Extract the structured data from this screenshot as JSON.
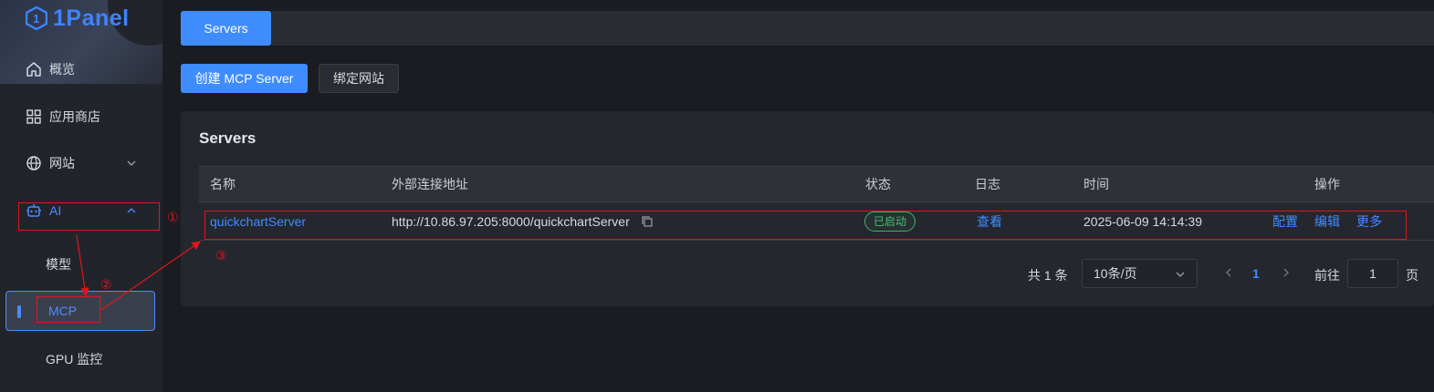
{
  "brand": {
    "name": "1Panel",
    "color": "#3f83ff"
  },
  "sidebar": {
    "items": [
      {
        "label": "概览",
        "icon": "home-icon"
      },
      {
        "label": "应用商店",
        "icon": "grid-icon"
      },
      {
        "label": "网站",
        "icon": "globe-icon"
      },
      {
        "label": "AI",
        "icon": "robot-icon"
      }
    ],
    "ai_children": [
      {
        "label": "模型"
      },
      {
        "label": "MCP",
        "active": true
      },
      {
        "label": "GPU 监控"
      }
    ]
  },
  "tabs": [
    {
      "label": "Servers",
      "active": true
    }
  ],
  "toolbar": {
    "create_label": "创建 MCP Server",
    "bind_label": "绑定网站"
  },
  "card": {
    "title": "Servers",
    "columns": [
      "名称",
      "外部连接地址",
      "状态",
      "日志",
      "时间",
      "操作"
    ],
    "rows": [
      {
        "name": "quickchartServer",
        "url": "http://10.86.97.205:8000/quickchartServer",
        "status": "已启动",
        "log": "查看",
        "time": "2025-06-09 14:14:39",
        "actions": [
          "配置",
          "编辑",
          "更多"
        ]
      }
    ]
  },
  "pagination": {
    "total": "共 1 条",
    "page_size": "10条/页",
    "current_page": "1",
    "goto_label": "前往",
    "goto_value": "1",
    "page_unit": "页"
  },
  "annotations": [
    "①",
    "②",
    "③"
  ],
  "colors": {
    "accent": "#3f8cff",
    "success": "#47c078",
    "annotation": "#e0161b"
  }
}
